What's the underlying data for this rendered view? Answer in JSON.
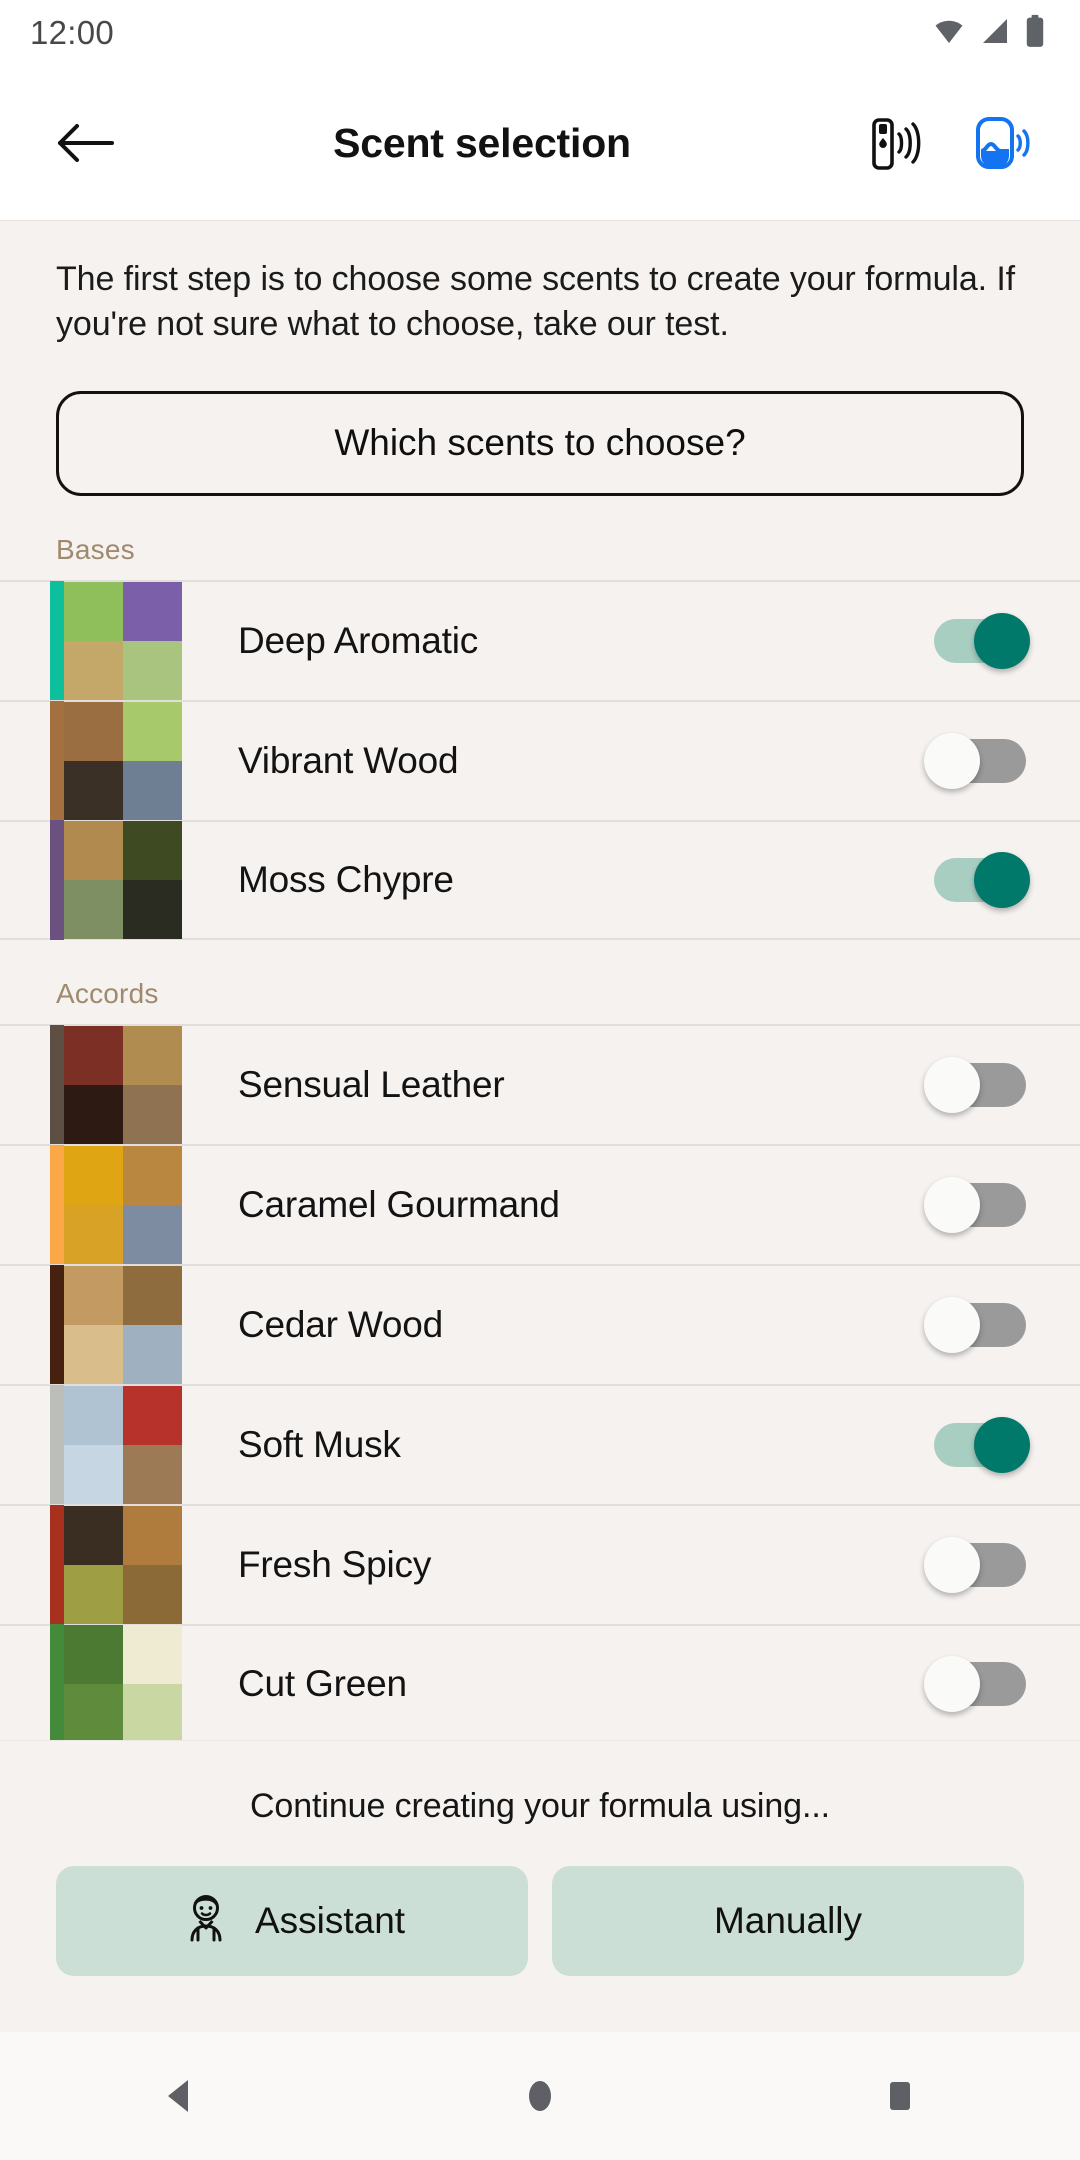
{
  "status_bar": {
    "time": "12:00",
    "icons": [
      "wifi-icon",
      "cellular-signal-icon",
      "battery-icon"
    ]
  },
  "app_bar": {
    "back_icon": "arrow-left-icon",
    "title": "Scent selection",
    "actions": [
      {
        "icon": "diffuser-pen-connected-icon",
        "color": "#111111"
      },
      {
        "icon": "device-connected-icon",
        "color": "#1373F0"
      }
    ]
  },
  "intro": {
    "text": "The first step is to choose some scents to create your formula. If you're not sure what to choose, take our test."
  },
  "which_button": {
    "label": "Which scents to choose?"
  },
  "sections": [
    {
      "title": "Bases",
      "items": [
        {
          "label": "Deep Aromatic",
          "accent": "#0DBF9C",
          "enabled": true,
          "swatch": [
            "#8EBF5A",
            "#7B5FA8",
            "#C4A86A",
            "#A9C47E"
          ]
        },
        {
          "label": "Vibrant Wood",
          "accent": "#A3703F",
          "enabled": false,
          "swatch": [
            "#9A6E41",
            "#A8C96B",
            "#3A3026",
            "#6E7F93"
          ]
        },
        {
          "label": "Moss Chypre",
          "accent": "#6B5180",
          "enabled": true,
          "swatch": [
            "#B08A4E",
            "#3E4A22",
            "#7E8F63",
            "#2A2C21"
          ]
        }
      ]
    },
    {
      "title": "Accords",
      "items": [
        {
          "label": "Sensual Leather",
          "accent": "#5E4F44",
          "enabled": false,
          "swatch": [
            "#7C2F24",
            "#B08C50",
            "#2C1A13",
            "#8E7252"
          ]
        },
        {
          "label": "Caramel Gourmand",
          "accent": "#FCA846",
          "enabled": false,
          "swatch": [
            "#E0A513",
            "#B9873F",
            "#D8A227",
            "#7D8CA0"
          ]
        },
        {
          "label": "Cedar Wood",
          "accent": "#46210F",
          "enabled": false,
          "swatch": [
            "#C29A62",
            "#8E6C3E",
            "#D9BE8B",
            "#9FB0C0"
          ]
        },
        {
          "label": "Soft Musk",
          "accent": "#BCBEBA",
          "enabled": true,
          "swatch": [
            "#AFC3D3",
            "#B8322C",
            "#C6D6E2",
            "#9C7A55"
          ]
        },
        {
          "label": "Fresh Spicy",
          "accent": "#A8301F",
          "enabled": false,
          "swatch": [
            "#3A2E22",
            "#B07C3E",
            "#9E9E45",
            "#8C6A38"
          ]
        },
        {
          "label": "Cut Green",
          "accent": "#448A3B",
          "enabled": false,
          "swatch": [
            "#4C7A33",
            "#EFEAD2",
            "#5E8B3C",
            "#C9D7A2"
          ]
        }
      ]
    }
  ],
  "bottom_sheet": {
    "caption": "Continue creating your formula using...",
    "buttons": [
      {
        "label": "Assistant",
        "icon": "assistant-person-icon"
      },
      {
        "label": "Manually",
        "icon": ""
      }
    ]
  },
  "nav_bar": {
    "buttons": [
      {
        "icon": "back-triangle-icon"
      },
      {
        "icon": "home-circle-icon"
      },
      {
        "icon": "recents-square-icon"
      }
    ]
  }
}
